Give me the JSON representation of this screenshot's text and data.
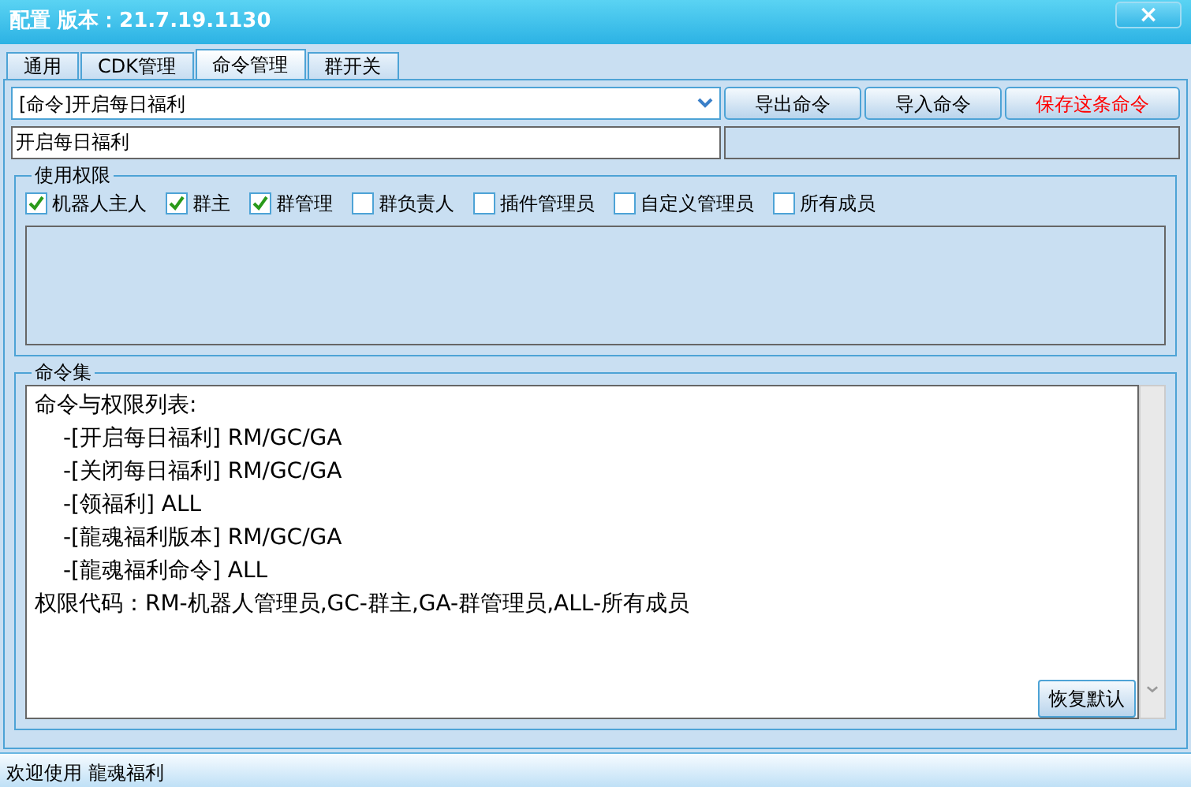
{
  "window": {
    "title": "配置 版本：21.7.19.1130",
    "close": "×"
  },
  "tabs": [
    {
      "label": "通用",
      "selected": false
    },
    {
      "label": "CDK管理",
      "selected": false
    },
    {
      "label": "命令管理",
      "selected": true
    },
    {
      "label": "群开关",
      "selected": false
    }
  ],
  "command_select": {
    "value": "[命令]开启每日福利"
  },
  "buttons": [
    {
      "label": "导出命令",
      "kind": "normal"
    },
    {
      "label": "导入命令",
      "kind": "normal"
    },
    {
      "label": "保存这条命令",
      "kind": "danger"
    }
  ],
  "name_field": {
    "value": "开启每日福利"
  },
  "permissions": {
    "title": "使用权限",
    "options": [
      {
        "label": "机器人主人",
        "checked": true
      },
      {
        "label": "群主",
        "checked": true
      },
      {
        "label": "群管理",
        "checked": true
      },
      {
        "label": "群负责人",
        "checked": false
      },
      {
        "label": "插件管理员",
        "checked": false
      },
      {
        "label": "自定义管理员",
        "checked": false
      },
      {
        "label": "所有成员",
        "checked": false
      }
    ]
  },
  "command_set": {
    "title": "命令集",
    "lines": [
      {
        "text": "命令与权限列表:",
        "indent": false
      },
      {
        "text": "-[开启每日福利] RM/GC/GA",
        "indent": true
      },
      {
        "text": "-[关闭每日福利] RM/GC/GA",
        "indent": true
      },
      {
        "text": "-[领福利] ALL",
        "indent": true
      },
      {
        "text": "-[龍魂福利版本] RM/GC/GA",
        "indent": true
      },
      {
        "text": "-[龍魂福利命令] ALL",
        "indent": true
      },
      {
        "text": "权限代码：RM-机器人管理员,GC-群主,GA-群管理员,ALL-所有成员",
        "indent": false
      }
    ],
    "reset_button": "恢复默认"
  },
  "status_bar": "欢迎使用 龍魂福利"
}
